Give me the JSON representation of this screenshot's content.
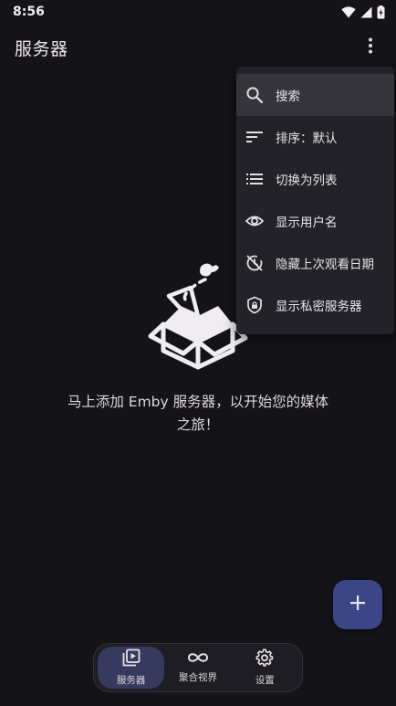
{
  "status_bar": {
    "time": "8:56"
  },
  "app_bar": {
    "title": "服务器",
    "more_icon": "more-vert-icon"
  },
  "menu": {
    "items": [
      {
        "label": "搜索",
        "icon": "search-icon"
      },
      {
        "label": "排序：默认",
        "icon": "sort-icon"
      },
      {
        "label": "切换为列表",
        "icon": "list-icon"
      },
      {
        "label": "显示用户名",
        "icon": "eye-icon"
      },
      {
        "label": "隐藏上次观看日期",
        "icon": "history-off-icon"
      },
      {
        "label": "显示私密服务器",
        "icon": "shield-lock-icon"
      }
    ]
  },
  "empty_state": {
    "message": "马上添加 Emby 服务器，以开始您的媒体之旅！"
  },
  "fab": {
    "icon": "plus-icon"
  },
  "bottom_nav": {
    "items": [
      {
        "label": "服务器",
        "icon": "video-library-icon",
        "selected": true
      },
      {
        "label": "聚合视界",
        "icon": "infinity-icon",
        "selected": false
      },
      {
        "label": "设置",
        "icon": "gear-icon",
        "selected": false
      }
    ]
  },
  "colors": {
    "background": "#141318",
    "menu_background": "#232228",
    "fab": "#3c4585",
    "nav_selected": "#363a5e"
  }
}
